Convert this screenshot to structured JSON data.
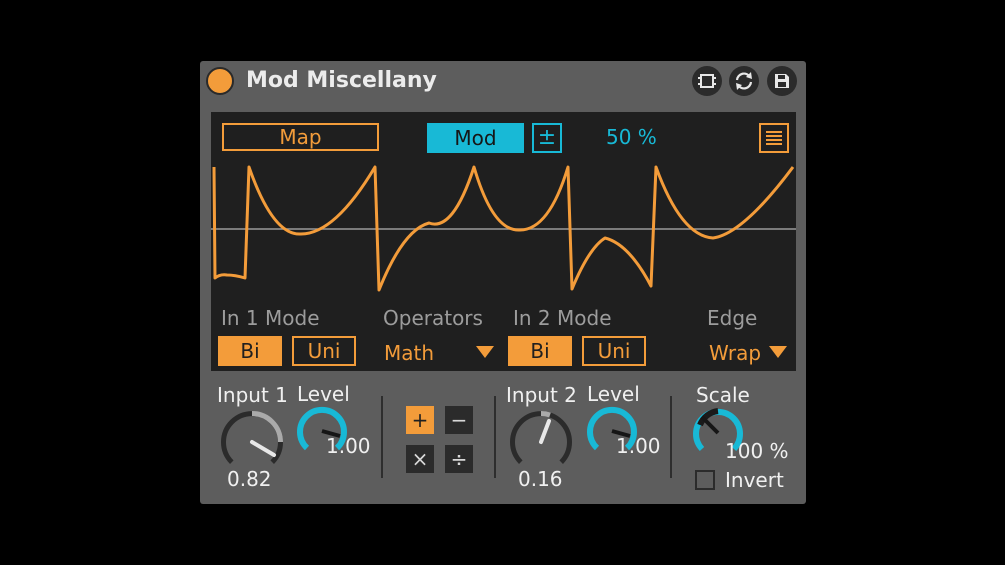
{
  "device": {
    "title": "Mod Miscellany",
    "colors": {
      "accent": "#f39c3a",
      "mod": "#18b9d6",
      "panel": "#5d5d5d",
      "display": "#1f1f1f"
    },
    "title_icons": [
      "power-icon",
      "resize-icon",
      "refresh-icon",
      "save-icon"
    ]
  },
  "display": {
    "map_label": "Map",
    "mod_label": "Mod",
    "bipolar_label": "±",
    "mod_amount": "50 %",
    "in1_mode": {
      "label": "In 1 Mode",
      "options": [
        "Bi",
        "Uni"
      ],
      "selected": "Bi"
    },
    "operators": {
      "label": "Operators",
      "value": "Math"
    },
    "in2_mode": {
      "label": "In 2 Mode",
      "options": [
        "Bi",
        "Uni"
      ],
      "selected": "Bi"
    },
    "edge": {
      "label": "Edge",
      "value": "Wrap"
    }
  },
  "controls": {
    "input1": {
      "label": "Input 1",
      "value": "0.82"
    },
    "level1": {
      "label": "Level",
      "value": "1.00"
    },
    "operators": [
      {
        "symbol": "+",
        "active": true
      },
      {
        "symbol": "−",
        "active": false
      },
      {
        "symbol": "×",
        "active": false
      },
      {
        "symbol": "÷",
        "active": false
      }
    ],
    "input2": {
      "label": "Input 2",
      "value": "0.16"
    },
    "level2": {
      "label": "Level",
      "value": "1.00"
    },
    "scale": {
      "label": "Scale",
      "value": "100 %"
    },
    "invert": {
      "label": "Invert",
      "checked": false
    }
  }
}
